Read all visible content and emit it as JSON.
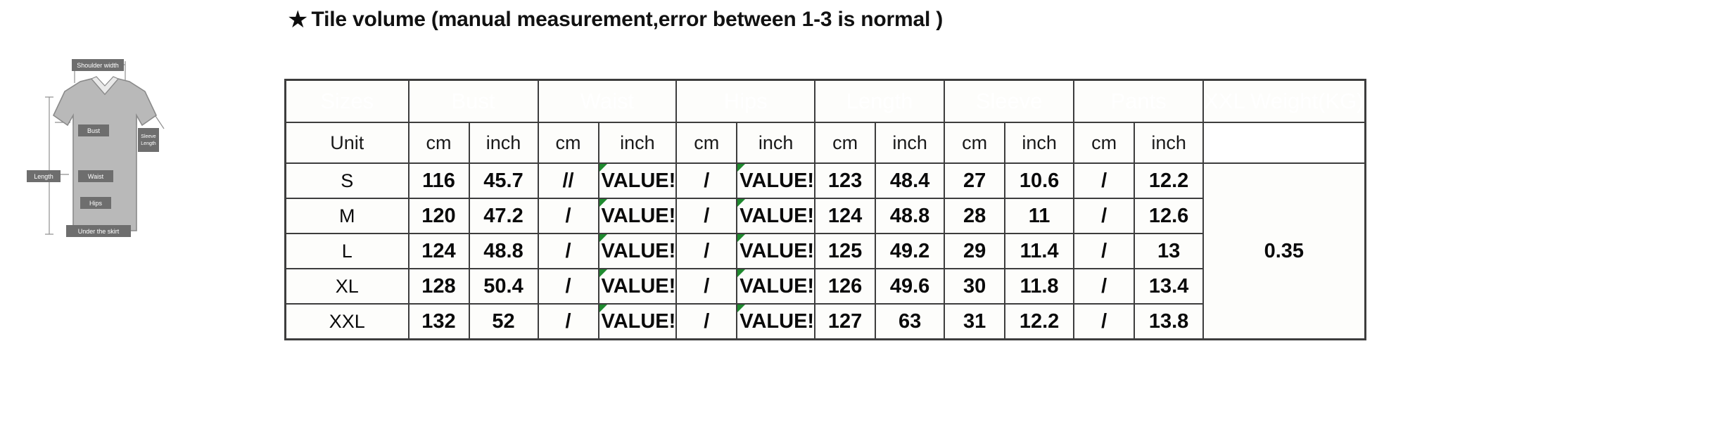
{
  "title": {
    "star": "★",
    "text": "Tile volume (manual measurement,error between 1-3 is normal )"
  },
  "diagram": {
    "name": "garment-measurement-diagram",
    "labels": {
      "shoulder": "Shoulder width",
      "bust": "Bust",
      "waist": "Waist",
      "hips": "Hips",
      "length": "Length",
      "sleeve": "Sleeve Length",
      "skirt": "Under the skirt"
    }
  },
  "table": {
    "group_headers": [
      "Sizes",
      "Bust",
      "Waist",
      "Hips",
      "Length",
      "Sleeve",
      "Pants",
      "XXL Weight(KG)"
    ],
    "unit_row": {
      "label": "Unit",
      "units": [
        "cm",
        "inch",
        "cm",
        "inch",
        "cm",
        "inch",
        "cm",
        "inch",
        "cm",
        "inch",
        "cm",
        "inch"
      ],
      "weight": ""
    },
    "rows": [
      {
        "size": "S",
        "bust_cm": "116",
        "bust_inch": "45.7",
        "waist_cm": "//",
        "waist_inch": "VALUE!",
        "hips_cm": "/",
        "hips_inch": "VALUE!",
        "length_cm": "123",
        "length_inch": "48.4",
        "sleeve_cm": "27",
        "sleeve_inch": "10.6",
        "pants_cm": "/",
        "pants_inch": "12.2"
      },
      {
        "size": "M",
        "bust_cm": "120",
        "bust_inch": "47.2",
        "waist_cm": "/",
        "waist_inch": "VALUE!",
        "hips_cm": "/",
        "hips_inch": "VALUE!",
        "length_cm": "124",
        "length_inch": "48.8",
        "sleeve_cm": "28",
        "sleeve_inch": "11",
        "pants_cm": "/",
        "pants_inch": "12.6"
      },
      {
        "size": "L",
        "bust_cm": "124",
        "bust_inch": "48.8",
        "waist_cm": "/",
        "waist_inch": "VALUE!",
        "hips_cm": "/",
        "hips_inch": "VALUE!",
        "length_cm": "125",
        "length_inch": "49.2",
        "sleeve_cm": "29",
        "sleeve_inch": "11.4",
        "pants_cm": "/",
        "pants_inch": "13"
      },
      {
        "size": "XL",
        "bust_cm": "128",
        "bust_inch": "50.4",
        "waist_cm": "/",
        "waist_inch": "VALUE!",
        "hips_cm": "/",
        "hips_inch": "VALUE!",
        "length_cm": "126",
        "length_inch": "49.6",
        "sleeve_cm": "30",
        "sleeve_inch": "11.8",
        "pants_cm": "/",
        "pants_inch": "13.4"
      },
      {
        "size": "XXL",
        "bust_cm": "132",
        "bust_inch": "52",
        "waist_cm": "/",
        "waist_inch": "VALUE!",
        "hips_cm": "/",
        "hips_inch": "VALUE!",
        "length_cm": "127",
        "length_inch": "63",
        "sleeve_cm": "31",
        "sleeve_inch": "12.2",
        "pants_cm": "/",
        "pants_inch": "13.8"
      }
    ],
    "weight_value": "0.35"
  },
  "colors": {
    "header_bg": "#575757",
    "header_text": "#ffffff",
    "cell_bg": "#fdfdfb",
    "border": "#3d3d3d",
    "text": "#0a0a0a",
    "error_flag": "#1f8a2f",
    "diagram_fill": "#b9b9b9",
    "diagram_label_bg": "#6e6e6e"
  }
}
